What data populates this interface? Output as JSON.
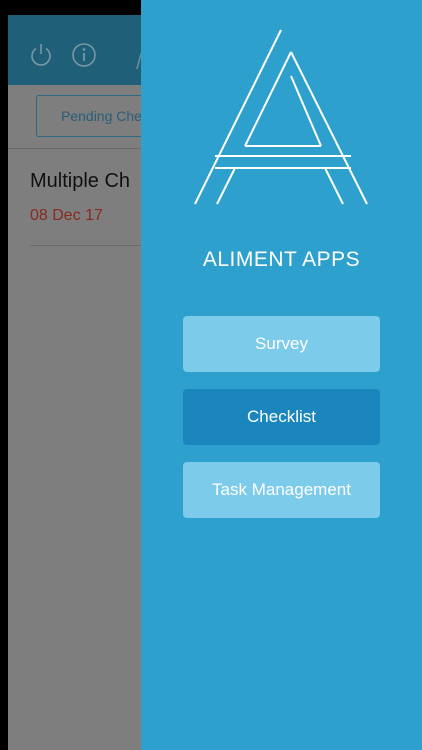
{
  "app": {
    "title_fragment": "/",
    "filter_label": "Pending Che",
    "list": [
      {
        "title": "Multiple Ch",
        "date": "08 Dec 17"
      }
    ]
  },
  "icons": {
    "power": "power-icon",
    "info": "info-icon",
    "logo": "aliment-logo"
  },
  "drawer": {
    "brand": "ALIMENT APPS",
    "menu": [
      {
        "label": "Survey",
        "style": "light"
      },
      {
        "label": "Checklist",
        "style": "dark"
      },
      {
        "label": "Task Management",
        "style": "light"
      }
    ]
  },
  "colors": {
    "drawer_bg": "#2ea0cd",
    "button_light": "#7dcbea",
    "button_dark": "#1a86bd",
    "header_bg": "#1f5f78",
    "date_red": "#8a2a20"
  }
}
